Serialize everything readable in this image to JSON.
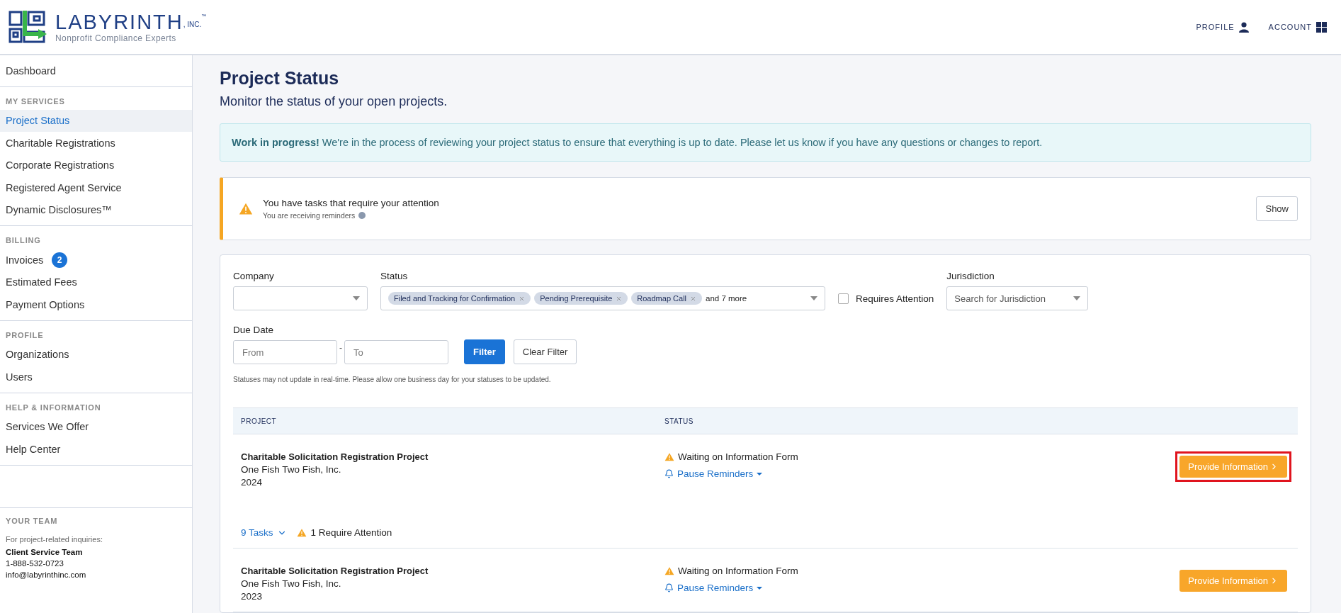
{
  "header": {
    "logo": {
      "name": "LABYRINTH",
      "suffix": ", INC.",
      "mark": "™",
      "tagline": "Nonprofit Compliance Experts"
    },
    "nav": [
      {
        "label": "PROFILE",
        "kind": "user"
      },
      {
        "label": "ACCOUNT",
        "kind": "grid"
      }
    ]
  },
  "sidebar": {
    "sections": [
      {
        "items": [
          {
            "label": "Dashboard",
            "selected": false
          }
        ]
      },
      {
        "heading": "MY SERVICES",
        "items": [
          {
            "label": "Project Status",
            "selected": true
          },
          {
            "label": "Charitable Registrations",
            "selected": false
          },
          {
            "label": "Corporate Registrations",
            "selected": false
          },
          {
            "label": "Registered Agent Service",
            "selected": false
          },
          {
            "label": "Dynamic Disclosures™",
            "selected": false
          }
        ]
      },
      {
        "heading": "BILLING",
        "items": [
          {
            "label": "Invoices",
            "selected": false,
            "badge": "2"
          },
          {
            "label": "Estimated Fees",
            "selected": false
          },
          {
            "label": "Payment Options",
            "selected": false
          }
        ]
      },
      {
        "heading": "PROFILE",
        "items": [
          {
            "label": "Organizations",
            "selected": false
          },
          {
            "label": "Users",
            "selected": false
          }
        ]
      },
      {
        "heading": "HELP & INFORMATION",
        "items": [
          {
            "label": "Services We Offer",
            "selected": false
          },
          {
            "label": "Help Center",
            "selected": false
          }
        ]
      }
    ],
    "team": {
      "heading": "YOUR TEAM",
      "note": "For project-related inquiries:",
      "name": "Client Service Team",
      "phone": "1-888-532-0723",
      "email": "info@labyrinthinc.com"
    }
  },
  "page": {
    "title": "Project Status",
    "subtitle": "Monitor the status of your open projects."
  },
  "notice": "**Work in progress!** We're in the process of reviewing your project status to ensure that everything is up to date. Please let us know if you have any questions or changes to report.",
  "attention": {
    "title": "You have tasks that require your attention",
    "subtitle": "You are receiving reminders",
    "button": "Show"
  },
  "filters": {
    "company": {
      "label": "Company"
    },
    "status": {
      "label": "Status",
      "tags": [
        "Filed and Tracking for Confirmation",
        "Pending Prerequisite",
        "Roadmap Call"
      ],
      "more": "and 7 more"
    },
    "requires": {
      "label": "Requires Attention",
      "checked": false
    },
    "jurisdiction": {
      "label": "Jurisdiction",
      "placeholder": "Search for Jurisdiction"
    },
    "due": {
      "label": "Due Date",
      "from_placeholder": "From",
      "separator": "-",
      "to_placeholder": "To"
    },
    "buttons": [
      {
        "label": "Filter",
        "kind": "primary"
      },
      {
        "label": "Clear Filter",
        "kind": "secondary"
      }
    ],
    "note": "Statuses may not update in real-time. Please allow one business day for your statuses to be updated."
  },
  "table": {
    "columns": [
      "PROJECT",
      "STATUS"
    ],
    "rows": [
      {
        "title": "Charitable Solicitation Registration Project",
        "org": "One Fish Two Fish, Inc.",
        "year": "2024",
        "status": "Waiting on Information Form",
        "reminder": "Pause Reminders",
        "action": "Provide Information",
        "highlighted": true,
        "tasks": "9 Tasks",
        "attention": "1 Require Attention"
      },
      {
        "title": "Charitable Solicitation Registration Project",
        "org": "One Fish Two Fish, Inc.",
        "year": "2023",
        "status": "Waiting on Information Form",
        "reminder": "Pause Reminders",
        "action": "Provide Information",
        "highlighted": false
      }
    ]
  }
}
